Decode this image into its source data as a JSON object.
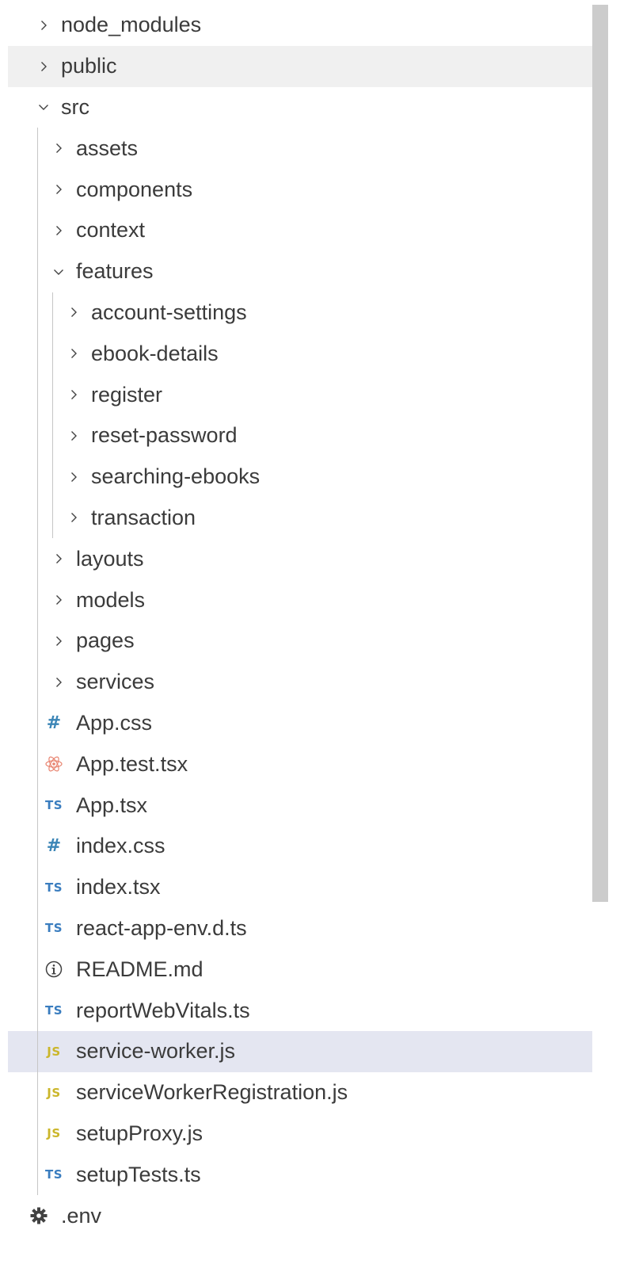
{
  "explorer": {
    "items": [
      {
        "label": "node_modules",
        "type": "folder",
        "expanded": false,
        "depth": 0,
        "state": "normal"
      },
      {
        "label": "public",
        "type": "folder",
        "expanded": false,
        "depth": 0,
        "state": "hover"
      },
      {
        "label": "src",
        "type": "folder",
        "expanded": true,
        "depth": 0,
        "state": "normal"
      },
      {
        "label": "assets",
        "type": "folder",
        "expanded": false,
        "depth": 1,
        "state": "normal"
      },
      {
        "label": "components",
        "type": "folder",
        "expanded": false,
        "depth": 1,
        "state": "normal"
      },
      {
        "label": "context",
        "type": "folder",
        "expanded": false,
        "depth": 1,
        "state": "normal"
      },
      {
        "label": "features",
        "type": "folder",
        "expanded": true,
        "depth": 1,
        "state": "normal"
      },
      {
        "label": "account-settings",
        "type": "folder",
        "expanded": false,
        "depth": 2,
        "state": "normal"
      },
      {
        "label": "ebook-details",
        "type": "folder",
        "expanded": false,
        "depth": 2,
        "state": "normal"
      },
      {
        "label": "register",
        "type": "folder",
        "expanded": false,
        "depth": 2,
        "state": "normal"
      },
      {
        "label": "reset-password",
        "type": "folder",
        "expanded": false,
        "depth": 2,
        "state": "normal"
      },
      {
        "label": "searching-ebooks",
        "type": "folder",
        "expanded": false,
        "depth": 2,
        "state": "normal"
      },
      {
        "label": "transaction",
        "type": "folder",
        "expanded": false,
        "depth": 2,
        "state": "normal"
      },
      {
        "label": "layouts",
        "type": "folder",
        "expanded": false,
        "depth": 1,
        "state": "normal"
      },
      {
        "label": "models",
        "type": "folder",
        "expanded": false,
        "depth": 1,
        "state": "normal"
      },
      {
        "label": "pages",
        "type": "folder",
        "expanded": false,
        "depth": 1,
        "state": "normal"
      },
      {
        "label": "services",
        "type": "folder",
        "expanded": false,
        "depth": 1,
        "state": "normal"
      },
      {
        "label": "App.css",
        "type": "file",
        "icon": "css-hash-icon",
        "icon_text": "#",
        "depth": 1,
        "state": "normal"
      },
      {
        "label": "App.test.tsx",
        "type": "file",
        "icon": "react-icon",
        "icon_text": "",
        "depth": 1,
        "state": "normal"
      },
      {
        "label": "App.tsx",
        "type": "file",
        "icon": "typescript-icon",
        "icon_text": "TS",
        "depth": 1,
        "state": "normal"
      },
      {
        "label": "index.css",
        "type": "file",
        "icon": "css-hash-icon",
        "icon_text": "#",
        "depth": 1,
        "state": "normal"
      },
      {
        "label": "index.tsx",
        "type": "file",
        "icon": "typescript-icon",
        "icon_text": "TS",
        "depth": 1,
        "state": "normal"
      },
      {
        "label": "react-app-env.d.ts",
        "type": "file",
        "icon": "typescript-icon",
        "icon_text": "TS",
        "depth": 1,
        "state": "normal"
      },
      {
        "label": "README.md",
        "type": "file",
        "icon": "info-icon",
        "icon_text": "",
        "depth": 1,
        "state": "normal"
      },
      {
        "label": "reportWebVitals.ts",
        "type": "file",
        "icon": "typescript-icon",
        "icon_text": "TS",
        "depth": 1,
        "state": "normal"
      },
      {
        "label": "service-worker.js",
        "type": "file",
        "icon": "javascript-icon",
        "icon_text": "JS",
        "depth": 1,
        "state": "selected"
      },
      {
        "label": "serviceWorkerRegistration.js",
        "type": "file",
        "icon": "javascript-icon",
        "icon_text": "JS",
        "depth": 1,
        "state": "normal"
      },
      {
        "label": "setupProxy.js",
        "type": "file",
        "icon": "javascript-icon",
        "icon_text": "JS",
        "depth": 1,
        "state": "normal"
      },
      {
        "label": "setupTests.ts",
        "type": "file",
        "icon": "typescript-icon",
        "icon_text": "TS",
        "depth": 1,
        "state": "normal"
      },
      {
        "label": ".env",
        "type": "file",
        "icon": "gear-icon",
        "icon_text": "",
        "depth": 0,
        "state": "normal"
      }
    ]
  },
  "colors": {
    "selected_row": "#e4e6f1",
    "hover_row": "#f0f0f0",
    "ts_icon": "#3a7dbf",
    "js_icon": "#cbb62a",
    "css_icon": "#3b85b6",
    "react_icon": "#e8836f",
    "text": "#3b3b3b"
  },
  "scrollbar": {
    "visible_fraction": 0.71
  }
}
